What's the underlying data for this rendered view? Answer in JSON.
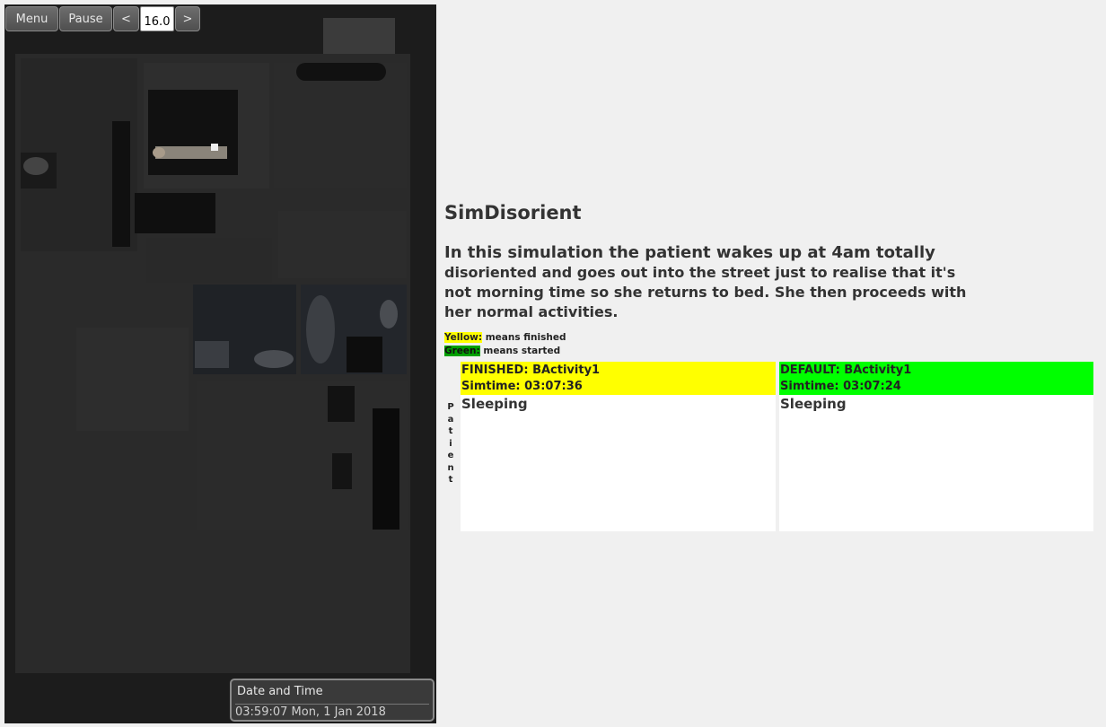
{
  "toolbar": {
    "menu_label": "Menu",
    "pause_label": "Pause",
    "prev_label": "<",
    "speed_value": "16.0",
    "next_label": ">"
  },
  "datetime": {
    "title": "Date and Time",
    "value": "03:59:07 Mon, 1 Jan 2018"
  },
  "info": {
    "title": "SimDisorient",
    "description_first": "In this simulation the patient wakes up at 4am totally",
    "description_rest": "disoriented and goes out into the street just to realise that it's not morning time so she returns to bed. She then proceeds with her normal activities."
  },
  "legend": {
    "yellow_word": "Yellow:",
    "yellow_text": " means finished",
    "green_word": "Green:",
    "green_text": " means started"
  },
  "agent_label": "Patient",
  "activities": [
    {
      "status_line": "FINISHED: BActivity1",
      "simtime_line": "Simtime:   03:07:36",
      "activity": "Sleeping",
      "color": "#ffff00"
    },
    {
      "status_line": "DEFAULT: BActivity1",
      "simtime_line": "Simtime:   03:07:24",
      "activity": "Sleeping",
      "color": "#00ff00"
    }
  ]
}
